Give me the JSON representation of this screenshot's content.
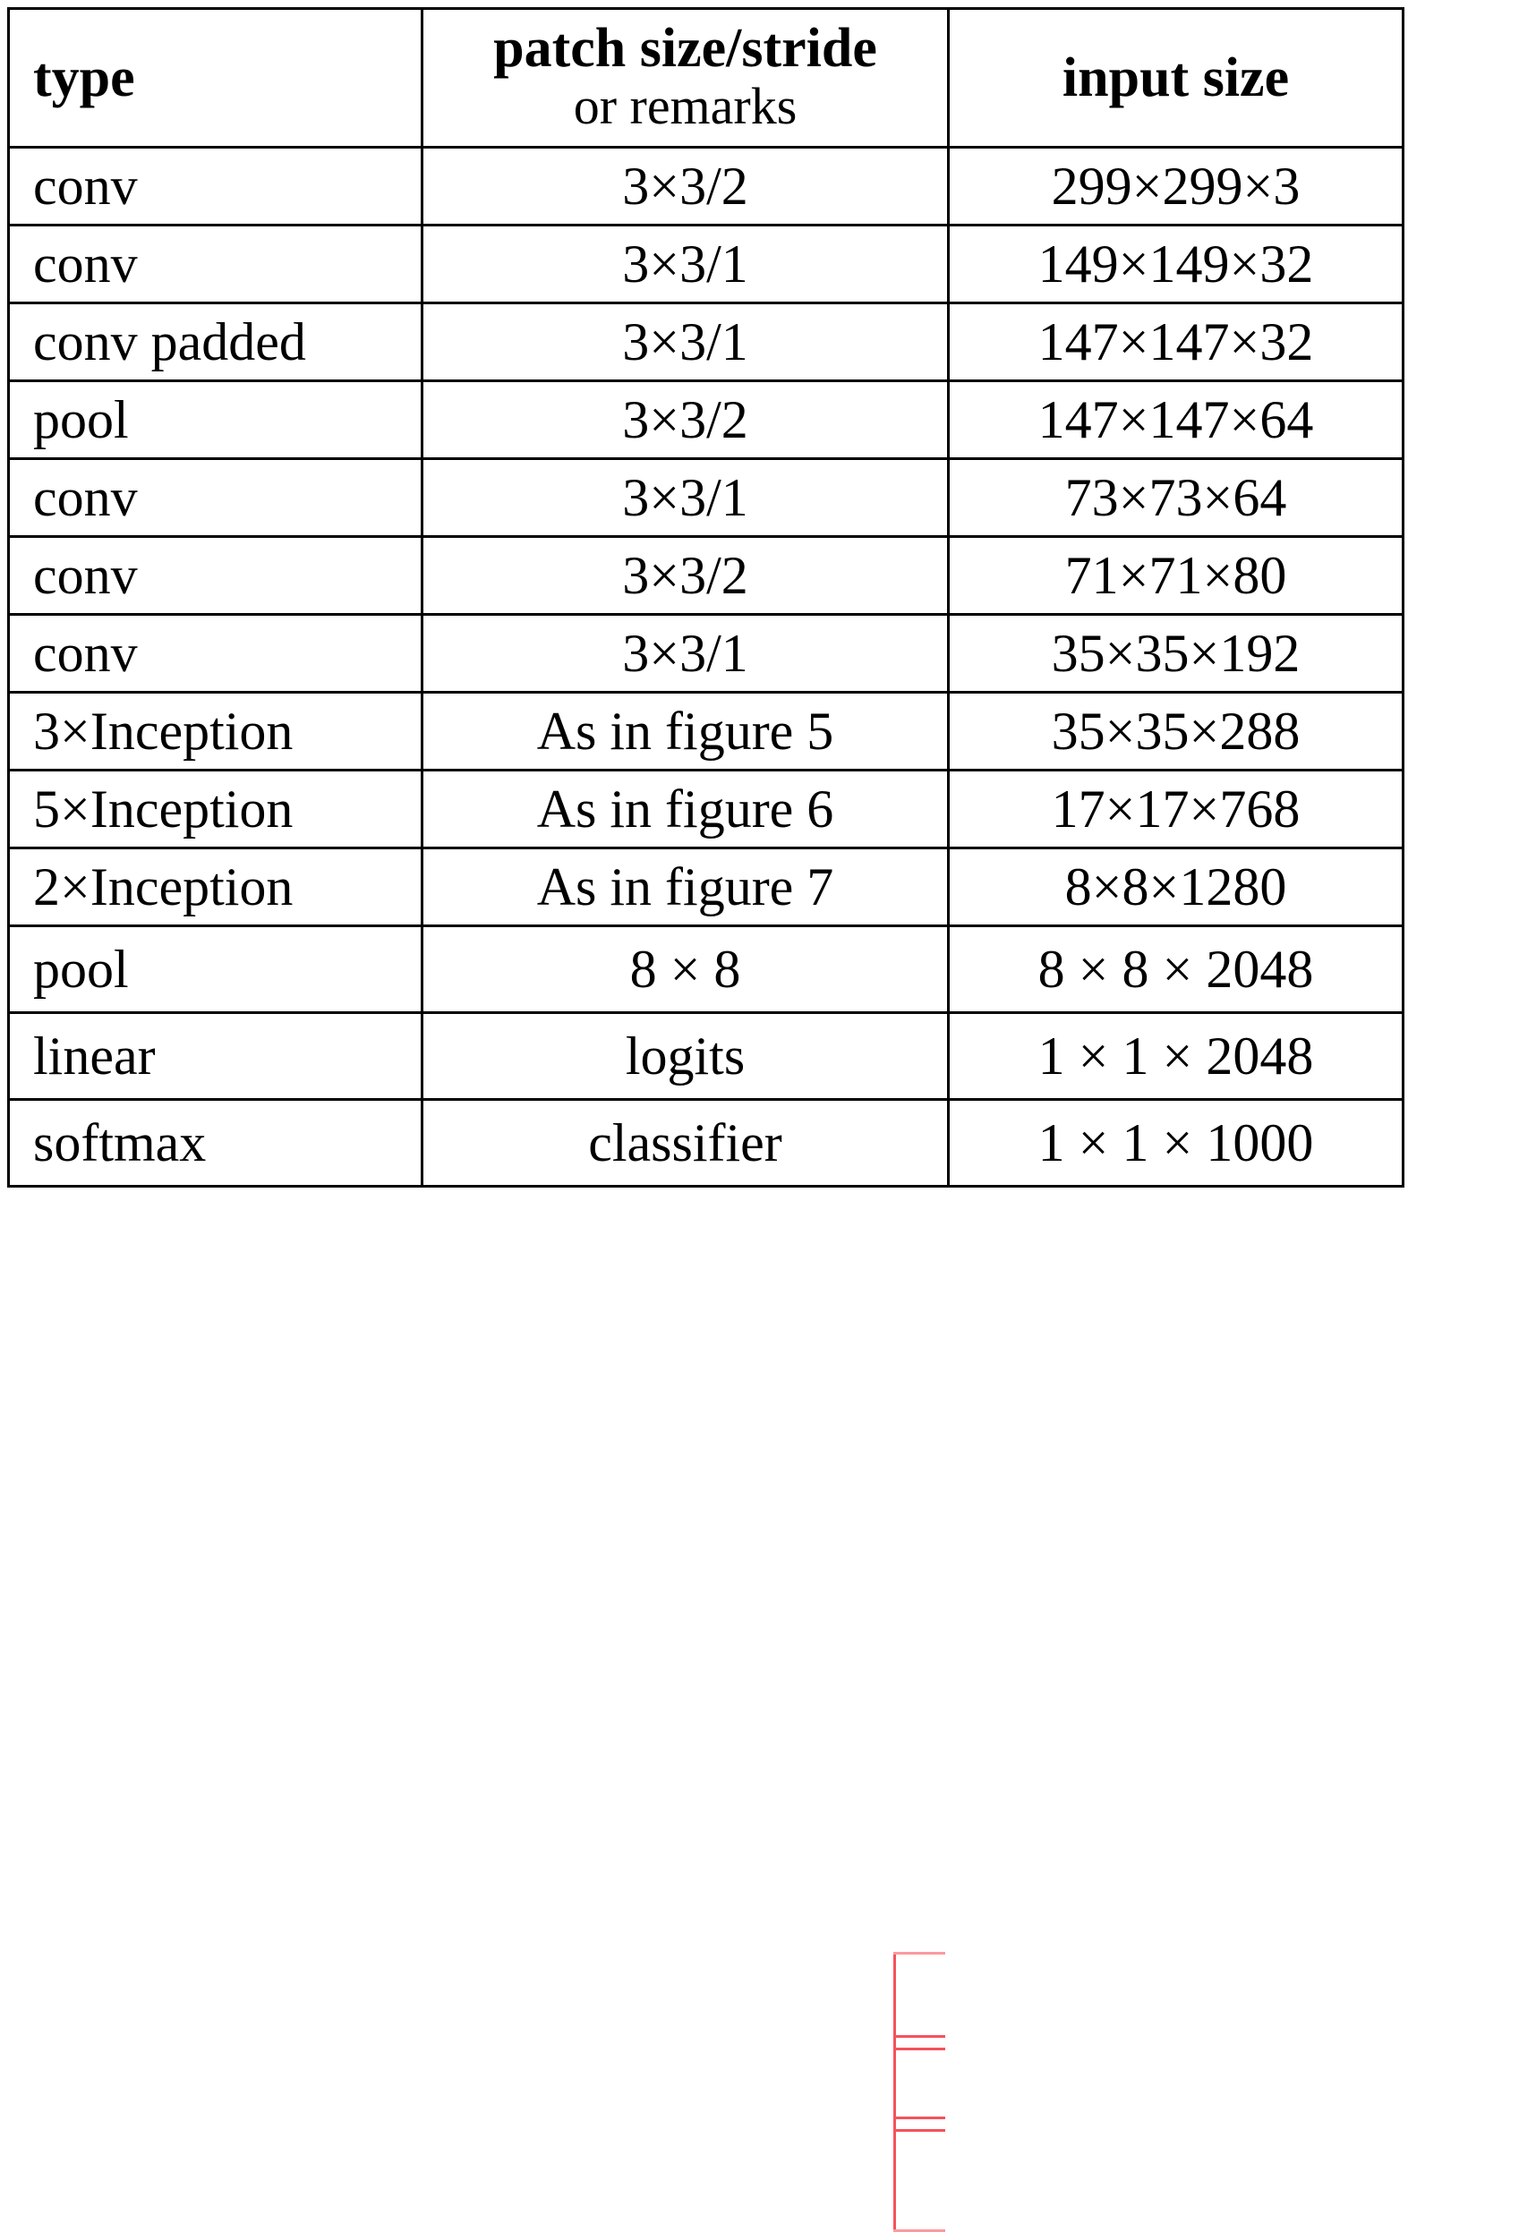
{
  "table": {
    "headers": {
      "col1": "type",
      "col2_line1": "patch size/stride",
      "col2_line2": "or remarks",
      "col3": "input size"
    },
    "rows": [
      {
        "type": "conv",
        "patch": "3×3/2",
        "input": "299×299×3"
      },
      {
        "type": "conv",
        "patch": "3×3/1",
        "input": "149×149×32"
      },
      {
        "type": "conv padded",
        "patch": "3×3/1",
        "input": "147×147×32"
      },
      {
        "type": "pool",
        "patch": "3×3/2",
        "input": "147×147×64"
      },
      {
        "type": "conv",
        "patch": "3×3/1",
        "input": "73×73×64"
      },
      {
        "type": "conv",
        "patch": "3×3/2",
        "input": "71×71×80"
      },
      {
        "type": "conv",
        "patch": "3×3/1",
        "input": "35×35×192"
      },
      {
        "type": "3×Inception",
        "patch": "As in figure 5",
        "input": "35×35×288"
      },
      {
        "type": "5×Inception",
        "patch": "As in figure 6",
        "input": "17×17×768"
      },
      {
        "type": "2×Inception",
        "patch": "As in figure 7",
        "input": "8×8×1280"
      },
      {
        "type": "pool",
        "patch": "8 × 8",
        "input": "8 × 8 × 2048"
      },
      {
        "type": "linear",
        "patch": "logits",
        "input": "1 × 1 × 2048"
      },
      {
        "type": "softmax",
        "patch": "classifier",
        "input": "1 × 1 × 1000"
      }
    ]
  },
  "annotation": {
    "color": "#f4525c",
    "target_label": "figure-number-highlight"
  }
}
